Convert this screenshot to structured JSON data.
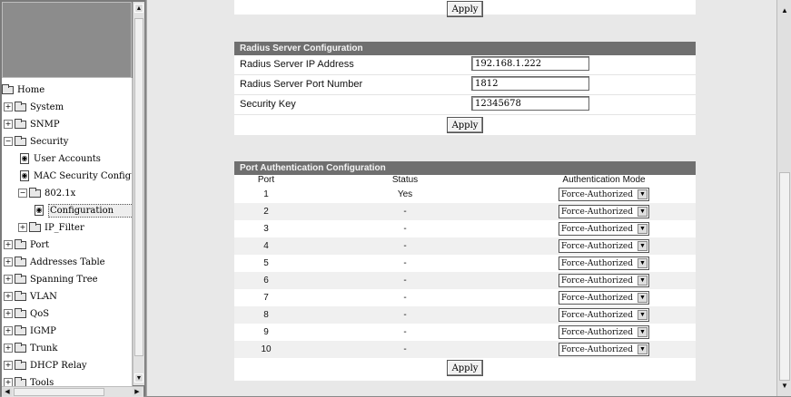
{
  "nav": {
    "items": [
      {
        "label": "Home"
      },
      {
        "label": "System"
      },
      {
        "label": "SNMP"
      },
      {
        "label": "Security"
      },
      {
        "label": "User Accounts"
      },
      {
        "label": "MAC Security Configu"
      },
      {
        "label": "802.1x"
      },
      {
        "label": "Configuration"
      },
      {
        "label": "IP_Filter"
      },
      {
        "label": "Port"
      },
      {
        "label": "Addresses Table"
      },
      {
        "label": "Spanning Tree"
      },
      {
        "label": "VLAN"
      },
      {
        "label": "QoS"
      },
      {
        "label": "IGMP"
      },
      {
        "label": "Trunk"
      },
      {
        "label": "DHCP Relay"
      },
      {
        "label": "Tools"
      }
    ]
  },
  "top_apply_label": "Apply",
  "radius": {
    "title": "Radius Server Configuration",
    "rows": [
      {
        "label": "Radius Server IP Address",
        "value": "192.168.1.222"
      },
      {
        "label": "Radius Server Port Number",
        "value": "1812"
      },
      {
        "label": "Security Key",
        "value": "12345678"
      }
    ],
    "apply_label": "Apply"
  },
  "portauth": {
    "title": "Port Authentication Configuration",
    "headers": {
      "port": "Port",
      "status": "Status",
      "mode": "Authentication Mode"
    },
    "rows": [
      {
        "port": "1",
        "status": "Yes",
        "mode": "Force-Authorized"
      },
      {
        "port": "2",
        "status": "-",
        "mode": "Force-Authorized"
      },
      {
        "port": "3",
        "status": "-",
        "mode": "Force-Authorized"
      },
      {
        "port": "4",
        "status": "-",
        "mode": "Force-Authorized"
      },
      {
        "port": "5",
        "status": "-",
        "mode": "Force-Authorized"
      },
      {
        "port": "6",
        "status": "-",
        "mode": "Force-Authorized"
      },
      {
        "port": "7",
        "status": "-",
        "mode": "Force-Authorized"
      },
      {
        "port": "8",
        "status": "-",
        "mode": "Force-Authorized"
      },
      {
        "port": "9",
        "status": "-",
        "mode": "Force-Authorized"
      },
      {
        "port": "10",
        "status": "-",
        "mode": "Force-Authorized"
      }
    ],
    "apply_label": "Apply"
  }
}
